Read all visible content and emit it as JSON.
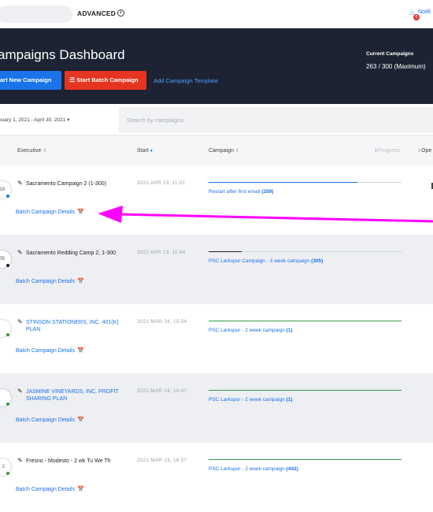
{
  "topbar": {
    "advanced_label": "ADVANCED",
    "notifications_label": "Notifi",
    "notification_count": "0"
  },
  "header": {
    "title": "ampaigns Dashboard",
    "current_campaigns_label": "Current Campaigns",
    "current_campaigns_value": "263 / 300 (Maximum)",
    "start_new_label": "art New Campaign",
    "start_batch_label": "Start Batch Campaign",
    "add_template_label": "Add Campaign Template"
  },
  "filter": {
    "date_range": "nuary 1, 2021 - April 30, 2021 ▾",
    "search_placeholder": "Search by campaigns"
  },
  "columns": {
    "executive": "Executive",
    "start": "Start",
    "campaign": "Campaign",
    "progress": "Progress",
    "operations": "Ope"
  },
  "colors": {
    "accent_blue": "#1a73e8",
    "batch_red": "#e5341f",
    "header_dark": "#1d2333",
    "progress_green": "#2e9b3f",
    "annotation_magenta": "#ff00ff"
  },
  "rows": [
    {
      "avatar": "19",
      "executive_line1": "Sacramento Campaign 2 (1-300)",
      "executive_line2": "",
      "start": "2021 APR 15, 11:01",
      "campaign": "Restart after first email (289)",
      "progress": 0.77,
      "bar_color": "#1a73e8",
      "details": "Batch Campaign Details"
    },
    {
      "avatar": "05",
      "executive_line1": "Sacramento Redding Camp 2, 1-300",
      "executive_line2": "",
      "start": "2021 APR 13, 11:44",
      "campaign": "PSC Larkspur Campaign - 3 week campaign (305)",
      "progress": 0.17,
      "bar_color": "#222222",
      "details": "Batch Campaign Details"
    },
    {
      "avatar": "",
      "executive_line1": "STINSON STATIONERS, INC. 401(K)",
      "executive_line2": "PLAN",
      "start": "2021 MAR 24, 15:54",
      "campaign": "PSC Larkspur - 2 week campaign (1)",
      "progress": 1.0,
      "bar_color": "#2e9b3f",
      "details": "Batch Campaign Details"
    },
    {
      "avatar": "",
      "executive_line1": "JASMINE VINEYARDS, INC. PROFIT",
      "executive_line2": "SHARING PLAN",
      "start": "2021 MAR 24, 10:47",
      "campaign": "PSC Larkspur - 2 week campaign (1)",
      "progress": 1.0,
      "bar_color": "#2e9b3f",
      "details": "Batch Campaign Details"
    },
    {
      "avatar": "2",
      "executive_line1": "Fresno - Modesto - 2 wk Tu We Th",
      "executive_line2": "",
      "start": "2021 MAR 23, 16:57",
      "campaign": "PSC Larkspur - 2 week campaign (442)",
      "progress": 1.0,
      "bar_color": "#2e9b3f",
      "details": "Batch Campaign Details"
    }
  ]
}
